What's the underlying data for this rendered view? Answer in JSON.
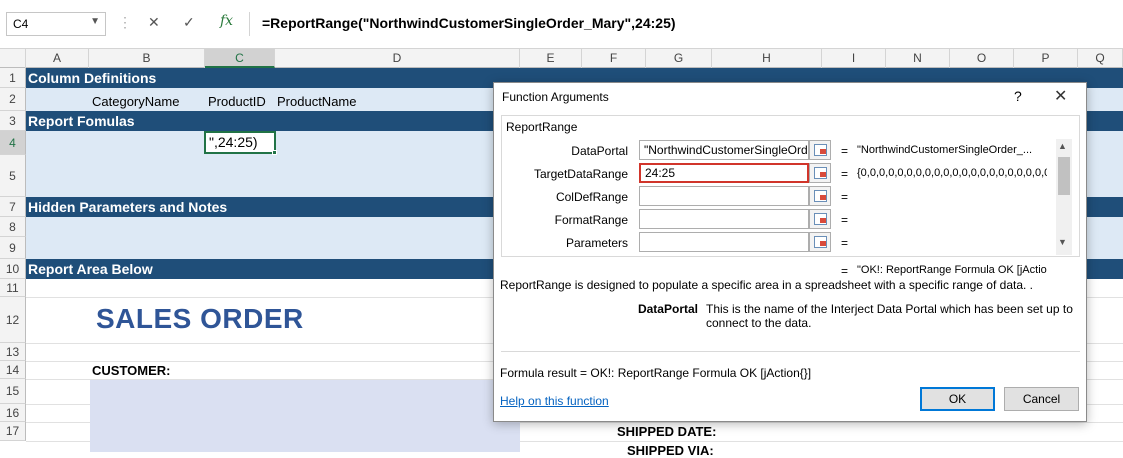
{
  "formula_bar": {
    "name_box": "C4",
    "cancel_glyph": "✕",
    "enter_glyph": "✓",
    "fx_label": "fx",
    "formula": "=ReportRange(\"NorthwindCustomerSingleOrder_Mary\",24:25)"
  },
  "columns": [
    "A",
    "B",
    "C",
    "D",
    "E",
    "F",
    "G",
    "H",
    "I",
    "N",
    "O",
    "P",
    "Q"
  ],
  "rows": [
    "1",
    "2",
    "3",
    "4",
    "5",
    "7",
    "8",
    "9",
    "10",
    "11",
    "12",
    "13",
    "14",
    "15",
    "16",
    "17"
  ],
  "sheet": {
    "bands": {
      "column_definitions": "Column Definitions",
      "report_formulas": "Report Fomulas",
      "hidden_parameters": "Hidden Parameters and Notes",
      "report_area": "Report Area Below"
    },
    "row2_headers": [
      "CategoryName",
      "ProductID",
      "ProductName"
    ],
    "active_cell_value": "\",24:25)",
    "title": "SALES ORDER",
    "customer_label": "CUSTOMER:",
    "shipped_date_label": "SHIPPED DATE:",
    "shipped_via_label": "SHIPPED VIA:"
  },
  "dialog": {
    "title": "Function Arguments",
    "help_glyph": "?",
    "close_glyph": "✕",
    "function_name": "ReportRange",
    "arguments": [
      {
        "label": "DataPortal",
        "value": "\"NorthwindCustomerSingleOrd",
        "result": "\"NorthwindCustomerSingleOrder_..."
      },
      {
        "label": "TargetDataRange",
        "value": "24:25",
        "result": "{0,0,0,0,0,0,0,0,0,0,0,0,0,0,0,0,0,0,0,0,0,0,0"
      },
      {
        "label": "ColDefRange",
        "value": "",
        "result": ""
      },
      {
        "label": "FormatRange",
        "value": "",
        "result": ""
      },
      {
        "label": "Parameters",
        "value": "",
        "result": ""
      }
    ],
    "equals": "=",
    "function_result": "\"OK!: ReportRange Formula OK [jActio",
    "description": "ReportRange is designed to populate a specific area in a spreadsheet with a specific range of data. .",
    "current_arg_name": "DataPortal",
    "current_arg_description": "This is the name of the Interject Data Portal which has been set up to connect to the data.",
    "formula_result": "Formula result =    OK!: ReportRange Formula OK [jAction{}]",
    "help_link": "Help on this function",
    "ok_label": "OK",
    "cancel_label": "Cancel"
  }
}
